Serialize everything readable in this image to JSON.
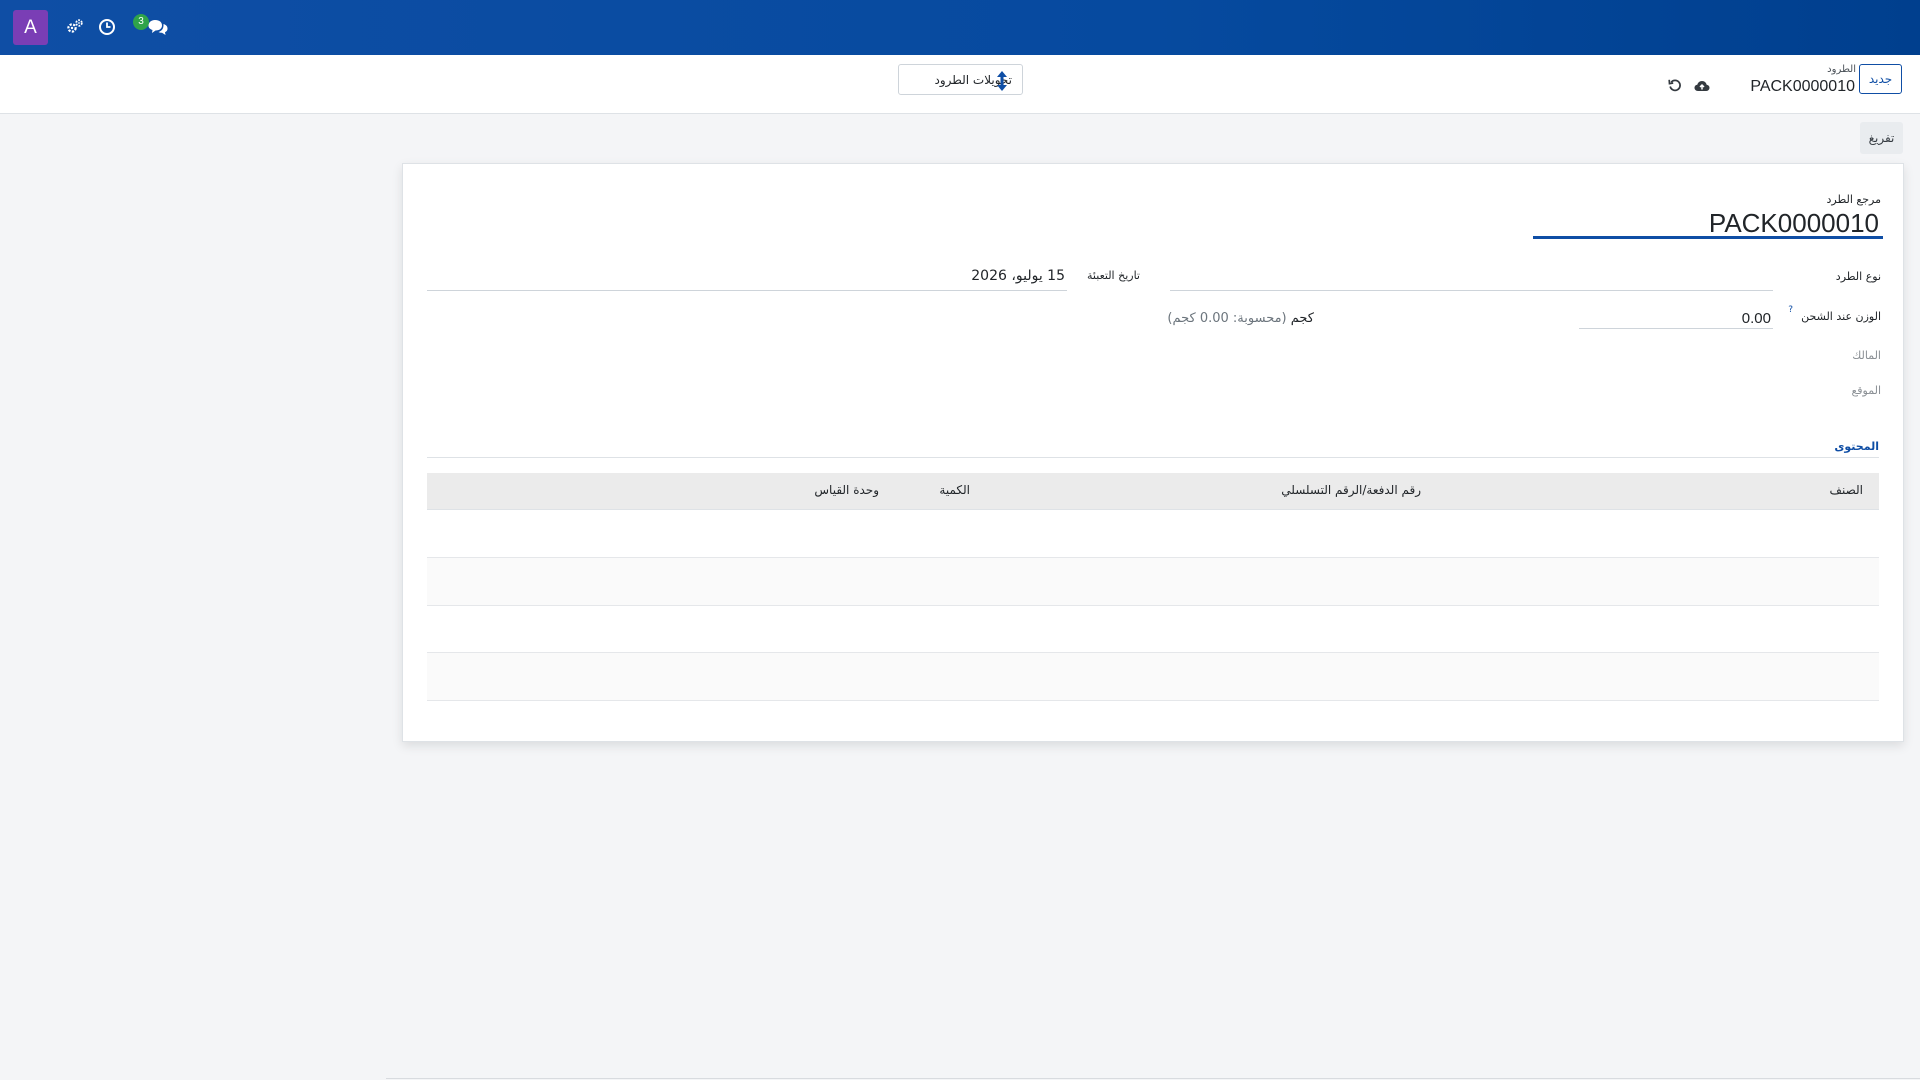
{
  "navbar": {
    "avatar_letter": "A",
    "messages_count": "3",
    "icons": [
      "settings-icon",
      "clock-icon",
      "chat-icon"
    ],
    "color": "#0f4ea5"
  },
  "control_panel": {
    "new_button": "جديد",
    "breadcrumb_parent": "الطرود",
    "breadcrumb_current": "PACK0000010",
    "smart_button_label": "تحويلات الطرود"
  },
  "status_bar": {
    "unpack_button": "تفريغ"
  },
  "form": {
    "package_ref_label": "مرجع الطرد",
    "package_ref_value": "PACK0000010",
    "package_type_label": "نوع الطرد",
    "package_type_value": "",
    "pack_date_label": "تاريخ التعبئة",
    "pack_date_value": "15 يوليو، 2026",
    "shipping_weight_label": "الوزن عند الشحن",
    "shipping_weight_help": "?",
    "shipping_weight_value": "0.00",
    "weight_unit": "كجم",
    "weight_computed": "(محسوبة: 0.00 كجم)",
    "owner_label": "المالك",
    "location_label": "الموقع",
    "content_section_title": "المحتوى"
  },
  "content_table": {
    "columns": [
      "الصنف",
      "رقم الدفعة/الرقم التسلسلي",
      "الكمية",
      "وحدة القياس"
    ],
    "rows": []
  }
}
